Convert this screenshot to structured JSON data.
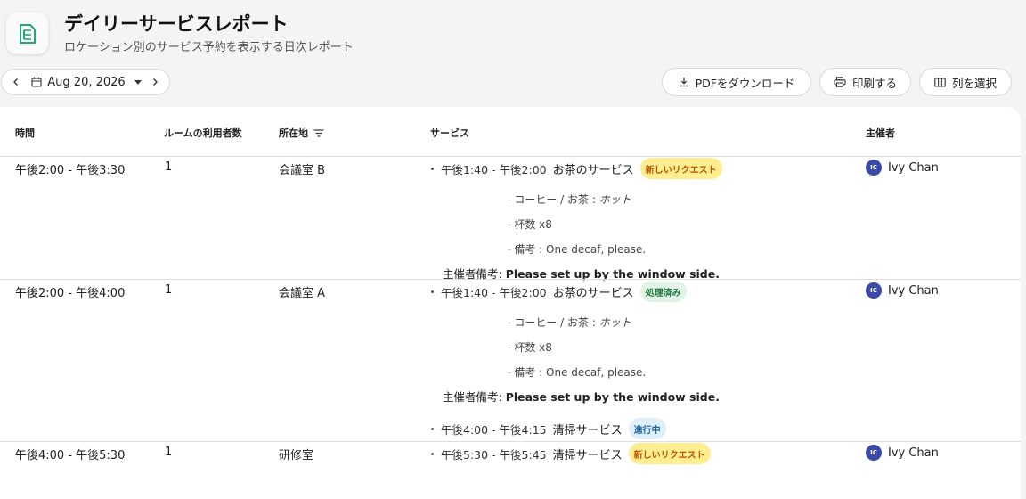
{
  "header": {
    "title": "デイリーサービスレポート",
    "subtitle": "ロケーション別のサービス予約を表示する日次レポート",
    "app_icon": "document-icon",
    "accent": "#1fa67a"
  },
  "toolbar": {
    "date": "Aug 20, 2026",
    "pdf_label": "PDFをダウンロード",
    "print_label": "印刷する",
    "columns_label": "列を選択"
  },
  "table": {
    "headers": {
      "time": "時間",
      "attendees": "ルームの利用者数",
      "location": "所在地",
      "service": "サービス",
      "host": "主催者"
    },
    "rows": [
      {
        "time": "午後2:00 - 午後3:30",
        "attendees": "1",
        "location": "会議室 B",
        "host_initials": "IC",
        "host": "Ivy Chan",
        "services": [
          {
            "time": "午後1:40 - 午後2:00",
            "name": "お茶のサービス",
            "status": "新しいリクエスト",
            "items": [
              {
                "label": "コーヒー / お茶 : ",
                "value": "ホット"
              },
              {
                "label": "杯数 x8",
                "value": ""
              },
              {
                "label": "備考 : ",
                "value": "One decaf, please."
              }
            ],
            "note_label": "主催者備考: ",
            "note_value": "Please set up by the window side."
          }
        ]
      },
      {
        "time": "午後2:00 - 午後4:00",
        "attendees": "1",
        "location": "会議室 A",
        "host_initials": "IC",
        "host": "Ivy Chan",
        "services": [
          {
            "time": "午後1:40 - 午後2:00",
            "name": "お茶のサービス",
            "status": "処理済み",
            "items": [
              {
                "label": "コーヒー / お茶 : ",
                "value": "ホット"
              },
              {
                "label": "杯数 x8",
                "value": ""
              },
              {
                "label": "備考 : ",
                "value": "One decaf, please."
              }
            ],
            "note_label": "主催者備考: ",
            "note_value": "Please set up by the window side."
          },
          {
            "time": "午後4:00 - 午後4:15",
            "name": "清掃サービス",
            "status": "進行中"
          }
        ]
      },
      {
        "time": "午後4:00 - 午後5:30",
        "attendees": "1",
        "location": "研修室",
        "host_initials": "IC",
        "host": "Ivy Chan",
        "services": [
          {
            "time": "午後5:30 - 午後5:45",
            "name": "清掃サービス",
            "status": "新しいリクエスト"
          }
        ]
      }
    ]
  }
}
